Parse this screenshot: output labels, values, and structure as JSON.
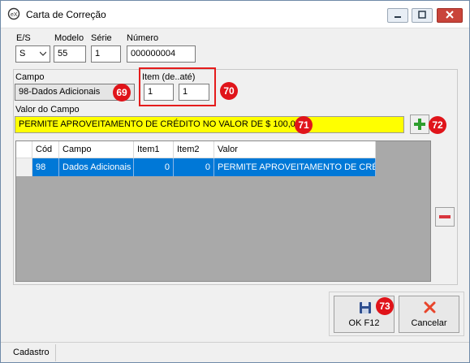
{
  "window": {
    "title": "Carta de Correção"
  },
  "header": {
    "es_label": "E/S",
    "es_value": "S",
    "modelo_label": "Modelo",
    "modelo_value": "55",
    "serie_label": "Série",
    "serie_value": "1",
    "numero_label": "Número",
    "numero_value": "000000004"
  },
  "campo": {
    "label": "Campo",
    "value": "98-Dados Adicionais",
    "item_label": "Item (de..até)",
    "item_from": "1",
    "item_to": "1",
    "valor_label": "Valor do Campo",
    "valor_value": "PERMITE APROVEITAMENTO DE CRÉDITO NO VALOR DE $ 100,00"
  },
  "grid": {
    "columns": [
      "Cód",
      "Campo",
      "Item1",
      "Item2",
      "Valor"
    ],
    "rows": [
      {
        "cod": "98",
        "campo": "Dados Adicionais",
        "item1": "0",
        "item2": "0",
        "valor": "PERMITE APROVEITAMENTO DE CRÉ..."
      }
    ]
  },
  "markers": {
    "m69": "69",
    "m70": "70",
    "m71": "71",
    "m72": "72",
    "m73": "73"
  },
  "buttons": {
    "ok_label": "OK  F12",
    "cancel_label": "Cancelar"
  },
  "status": {
    "tab": "Cadastro"
  },
  "colors": {
    "accent": "#0078d7",
    "highlight_field": "#ffff00",
    "marker": "#e0141a",
    "add": "#2e9e2e",
    "remove": "#d9363e"
  }
}
